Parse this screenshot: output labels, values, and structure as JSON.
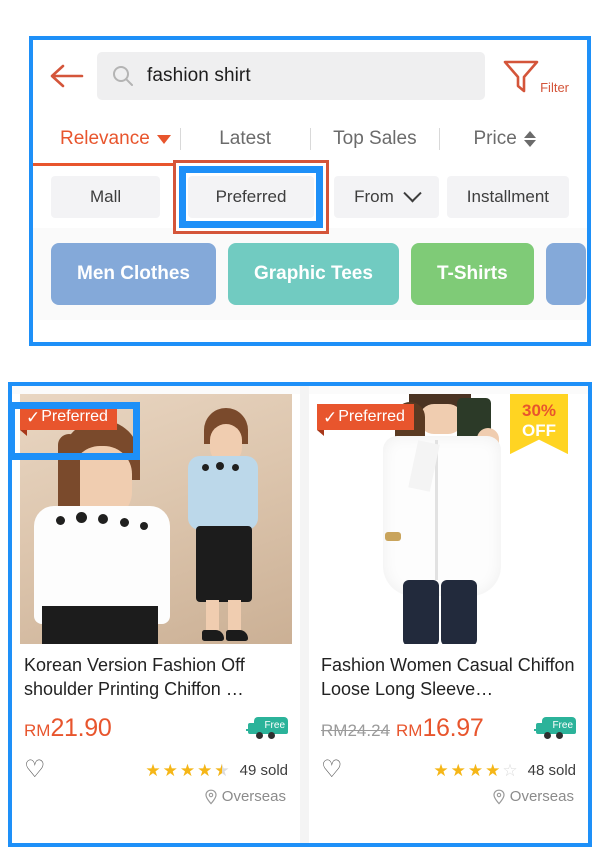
{
  "colors": {
    "annotation_blue": "#1e90f8",
    "brand_orange": "#e8552d",
    "badge_yellow": "#ffd422",
    "free_teal": "#2bb39a",
    "star_gold": "#f5b617"
  },
  "header": {
    "back_icon": "back-arrow-icon",
    "search": {
      "icon": "search-icon",
      "value": "fashion shirt",
      "placeholder": "Search"
    },
    "filter": {
      "icon": "funnel-icon",
      "label": "Filter"
    }
  },
  "sort_tabs": [
    {
      "label": "Relevance",
      "active": true,
      "indicator": "caret-down"
    },
    {
      "label": "Latest",
      "active": false,
      "indicator": "none"
    },
    {
      "label": "Top Sales",
      "active": false,
      "indicator": "none"
    },
    {
      "label": "Price",
      "active": false,
      "indicator": "up-down-arrows"
    }
  ],
  "filter_chips": [
    {
      "label": "Mall",
      "highlighted": false,
      "indicator": "none"
    },
    {
      "label": "Preferred",
      "highlighted": true,
      "indicator": "none"
    },
    {
      "label": "From",
      "highlighted": false,
      "indicator": "chevron-down"
    },
    {
      "label": "Installment",
      "highlighted": false,
      "indicator": "none"
    }
  ],
  "category_chips": [
    {
      "label": "Men Clothes",
      "color": "#84a9d9"
    },
    {
      "label": "Graphic Tees",
      "color": "#71cbc1"
    },
    {
      "label": "T-Shirts",
      "color": "#7fcb77"
    },
    {
      "label": "",
      "color": "#84a9d9"
    }
  ],
  "products": [
    {
      "title": "Korean Version Fashion Off shoulder Printing Chiffon …",
      "preferred_badge": "Preferred",
      "discount_badge": null,
      "price_old": null,
      "currency": "RM",
      "price": "21.90",
      "free_shipping_label": "Free",
      "stars_full": 4,
      "stars_half": 1,
      "stars_empty": 0,
      "sold": "49 sold",
      "location": "Overseas",
      "favorite_icon": "heart-outline-icon"
    },
    {
      "title": "Fashion Women Casual Chiffon Loose Long Sleeve…",
      "preferred_badge": "Preferred",
      "discount_badge": {
        "line1": "30%",
        "line2": "OFF"
      },
      "price_old": "RM24.24",
      "currency": "RM",
      "price": "16.97",
      "free_shipping_label": "Free",
      "stars_full": 4,
      "stars_half": 0,
      "stars_empty": 1,
      "sold": "48 sold",
      "location": "Overseas",
      "favorite_icon": "heart-outline-icon"
    }
  ]
}
